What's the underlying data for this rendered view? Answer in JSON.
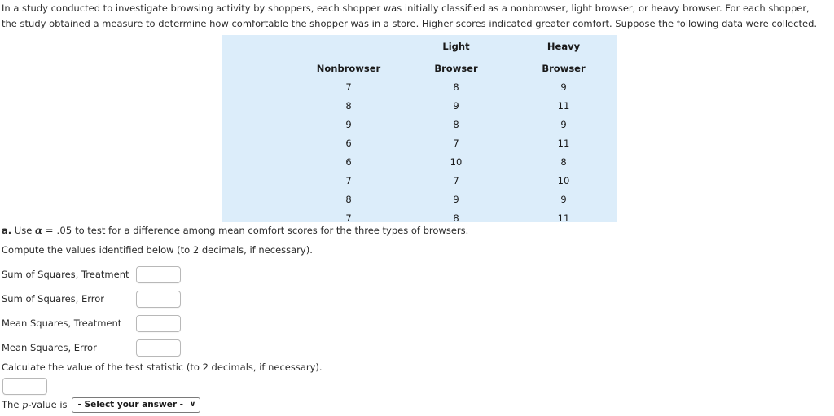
{
  "intro": {
    "paragraph": "In a study conducted to investigate browsing activity by shoppers, each shopper was initially classified as a nonbrowser, light browser, or heavy browser. For each shopper, the study obtained a measure to determine how comfortable the shopper was in a store. Higher scores indicated greater comfort. Suppose the following data were collected."
  },
  "table": {
    "background_color": "#dcedfa",
    "headers_top": [
      "",
      "Light",
      "Heavy"
    ],
    "headers_bottom": [
      "Nonbrowser",
      "Browser",
      "Browser"
    ],
    "rows": [
      [
        "7",
        "8",
        "9"
      ],
      [
        "8",
        "9",
        "11"
      ],
      [
        "9",
        "8",
        "9"
      ],
      [
        "6",
        "7",
        "11"
      ],
      [
        "6",
        "10",
        "8"
      ],
      [
        "7",
        "7",
        "10"
      ],
      [
        "8",
        "9",
        "9"
      ],
      [
        "7",
        "8",
        "11"
      ]
    ]
  },
  "part_a": {
    "label": "a.",
    "text_before_alpha": "Use",
    "alpha_symbol": "α",
    "equals_value": "= .05",
    "text_after_alpha": "to test for a difference among mean comfort scores for the three types of browsers.",
    "compute_instruction": "Compute the values identified below (to 2 decimals, if necessary)."
  },
  "fields": [
    {
      "label": "Sum of Squares, Treatment",
      "value": "",
      "placeholder": ""
    },
    {
      "label": "Sum of Squares, Error",
      "value": "",
      "placeholder": ""
    },
    {
      "label": "Mean Squares, Treatment",
      "value": "",
      "placeholder": ""
    },
    {
      "label": "Mean Squares, Error",
      "value": "",
      "placeholder": ""
    }
  ],
  "test_statistic": {
    "instruction": "Calculate the value of the test statistic (to 2 decimals, if necessary).",
    "value": "",
    "placeholder": ""
  },
  "p_value": {
    "label_prefix": "The",
    "label_italic": "p",
    "label_suffix": "-value is",
    "selected_option": "- Select your answer -",
    "caret_icon": "∨"
  }
}
